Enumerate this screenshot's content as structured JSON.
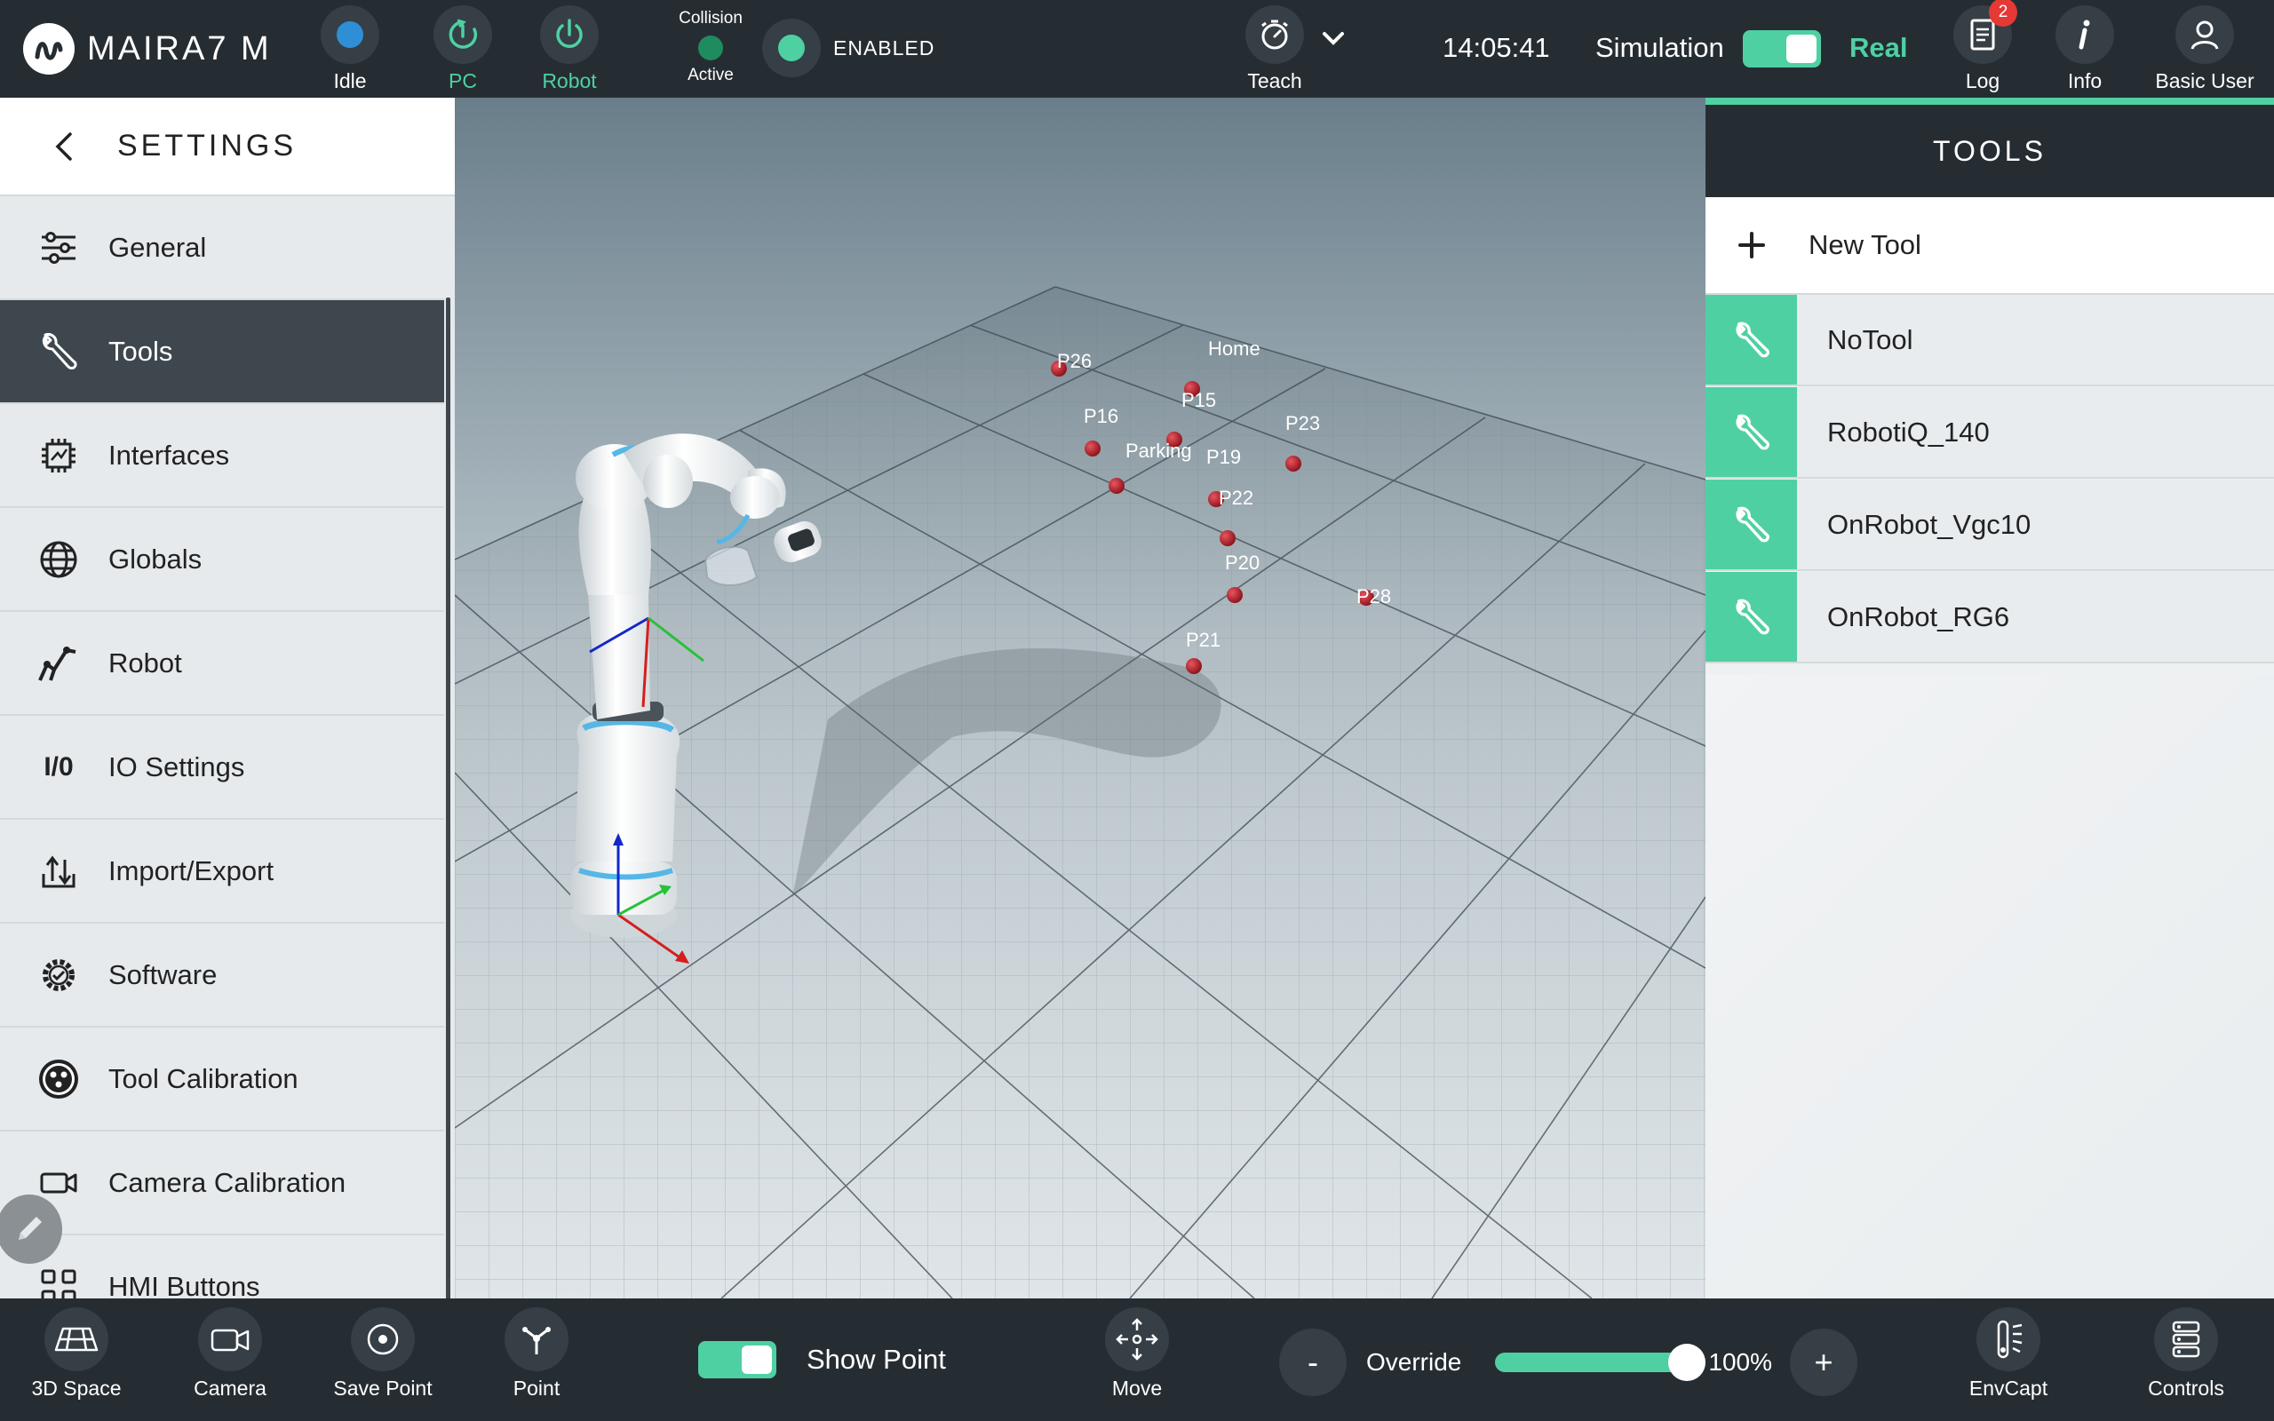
{
  "app": {
    "title": "MAIRA7 M"
  },
  "topbar": {
    "idle_label": "Idle",
    "pc_label": "PC",
    "robot_label": "Robot",
    "collision_title": "Collision",
    "collision_status": "Active",
    "enabled_label": "ENABLED",
    "teach_label": "Teach",
    "clock": "14:05:41",
    "simulation_label": "Simulation",
    "real_label": "Real",
    "log_label": "Log",
    "log_badge": "2",
    "info_label": "Info",
    "user_label": "Basic User"
  },
  "sidebar": {
    "title": "SETTINGS",
    "items": [
      {
        "label": "General",
        "icon": "sliders-icon"
      },
      {
        "label": "Tools",
        "icon": "wrench-icon",
        "active": true
      },
      {
        "label": "Interfaces",
        "icon": "chip-icon"
      },
      {
        "label": "Globals",
        "icon": "globe-icon"
      },
      {
        "label": "Robot",
        "icon": "robot-arm-icon"
      },
      {
        "label": "IO Settings",
        "icon": "io-icon",
        "icon_text": "I/0"
      },
      {
        "label": "Import/Export",
        "icon": "import-export-icon"
      },
      {
        "label": "Software",
        "icon": "software-gear-icon"
      },
      {
        "label": "Tool Calibration",
        "icon": "tool-calibration-icon"
      },
      {
        "label": "Camera Calibration",
        "icon": "camera-calibration-icon"
      },
      {
        "label": "HMI Buttons",
        "icon": "grid-icon"
      }
    ]
  },
  "viewport": {
    "points": [
      "P26",
      "Home",
      "P15",
      "P16",
      "Parking",
      "P23",
      "P19",
      "P22",
      "P20",
      "P28",
      "P21"
    ]
  },
  "tools": {
    "title": "TOOLS",
    "new_tool_label": "New Tool",
    "items": [
      "NoTool",
      "RobotiQ_140",
      "OnRobot_Vgc10",
      "OnRobot_RG6"
    ]
  },
  "bottombar": {
    "space_label": "3D Space",
    "camera_label": "Camera",
    "save_point_label": "Save Point",
    "point_label": "Point",
    "show_point_label": "Show Point",
    "move_label": "Move",
    "minus_label": "-",
    "override_label": "Override",
    "override_value": "100%",
    "override_fraction": 1.0,
    "plus_label": "+",
    "envcapt_label": "EnvCapt",
    "controls_label": "Controls"
  },
  "colors": {
    "accent": "#4fd0a3",
    "bar_bg": "#262d32",
    "badge": "#e53935",
    "idle_dot": "#2f8fd6",
    "point_marker": "#b0202a"
  }
}
